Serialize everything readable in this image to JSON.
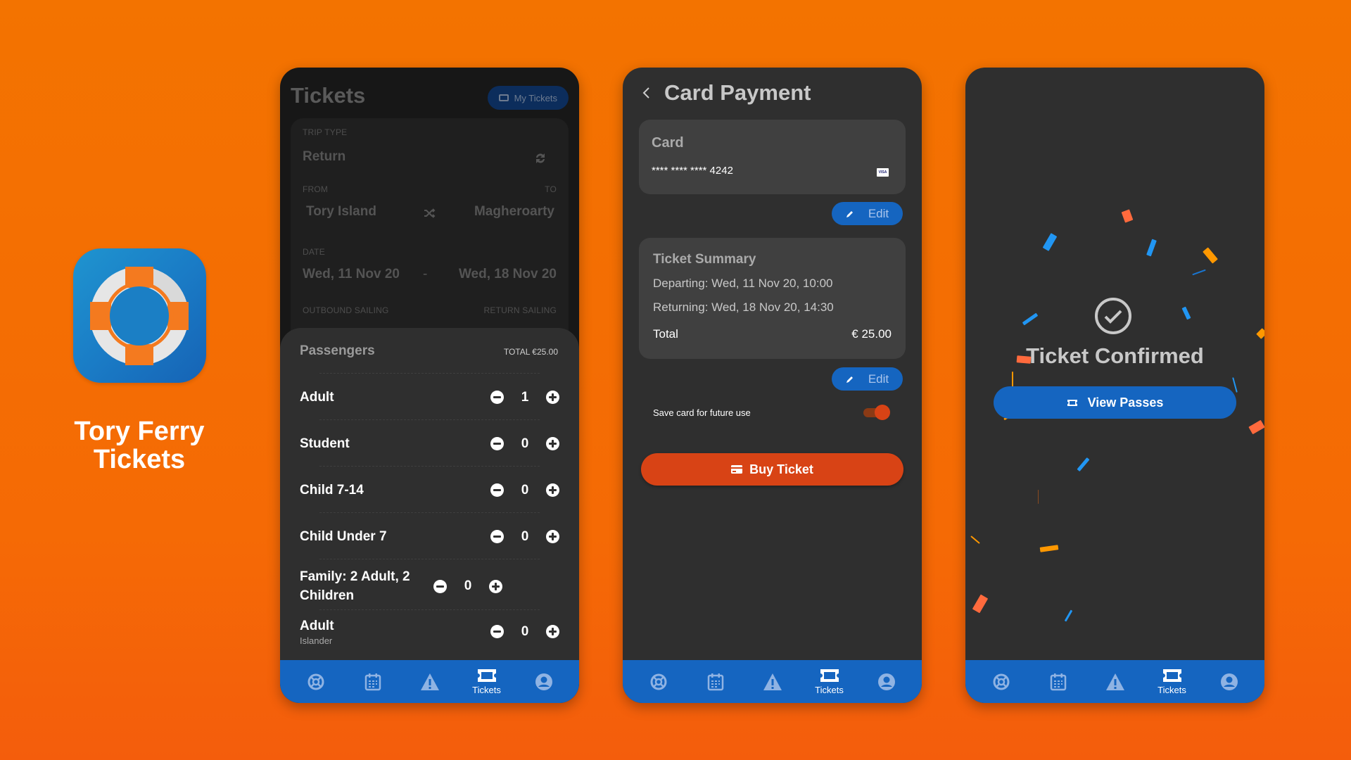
{
  "branding": {
    "app_name_line1": "Tory Ferry",
    "app_name_line2": "Tickets",
    "icon": "lifebuoy-icon",
    "colors": {
      "background": "#f37300",
      "accent_blue": "#1565c0",
      "accent_orange": "#d84315"
    }
  },
  "nav": {
    "items": [
      {
        "icon": "lifebuoy-icon",
        "label": ""
      },
      {
        "icon": "calendar-icon",
        "label": ""
      },
      {
        "icon": "warning-icon",
        "label": ""
      },
      {
        "icon": "ticket-icon",
        "label": "Tickets",
        "active": true
      },
      {
        "icon": "account-icon",
        "label": ""
      }
    ]
  },
  "tickets_screen": {
    "title": "Tickets",
    "my_tickets_label": "My Tickets",
    "trip_type_label": "TRIP TYPE",
    "trip_type_value": "Return",
    "from_label": "FROM",
    "to_label": "TO",
    "from_value": "Tory Island",
    "to_value": "Magheroarty",
    "date_label": "DATE",
    "date_out": "Wed, 11 Nov 20",
    "date_sep": "-",
    "date_return": "Wed, 18 Nov 20",
    "outbound_label": "OUTBOUND SAILING",
    "return_label": "RETURN SAILING",
    "passengers_title": "Passengers",
    "total_label": "TOTAL €25.00",
    "passengers": [
      {
        "name": "Adult",
        "sub": "",
        "count": "1"
      },
      {
        "name": "Student",
        "sub": "",
        "count": "0"
      },
      {
        "name": "Child 7-14",
        "sub": "",
        "count": "0"
      },
      {
        "name": "Child Under 7",
        "sub": "",
        "count": "0"
      },
      {
        "name": "Family: 2 Adult, 2 Children",
        "sub": "",
        "count": "0"
      },
      {
        "name": "Adult",
        "sub": "Islander",
        "count": "0"
      }
    ]
  },
  "payment_screen": {
    "title": "Card Payment",
    "card_label": "Card",
    "card_number": "**** **** **** 4242",
    "card_brand": "VISA",
    "edit_label": "Edit",
    "summary_title": "Ticket Summary",
    "departing": "Departing: Wed, 11 Nov 20, 10:00",
    "returning": "Returning: Wed, 18 Nov 20, 14:30",
    "total_label": "Total",
    "total_value": "€ 25.00",
    "save_card_label": "Save card for future use",
    "save_card_on": true,
    "buy_label": "Buy Ticket"
  },
  "confirm_screen": {
    "title": "Ticket Confirmed",
    "view_passes_label": "View Passes"
  }
}
